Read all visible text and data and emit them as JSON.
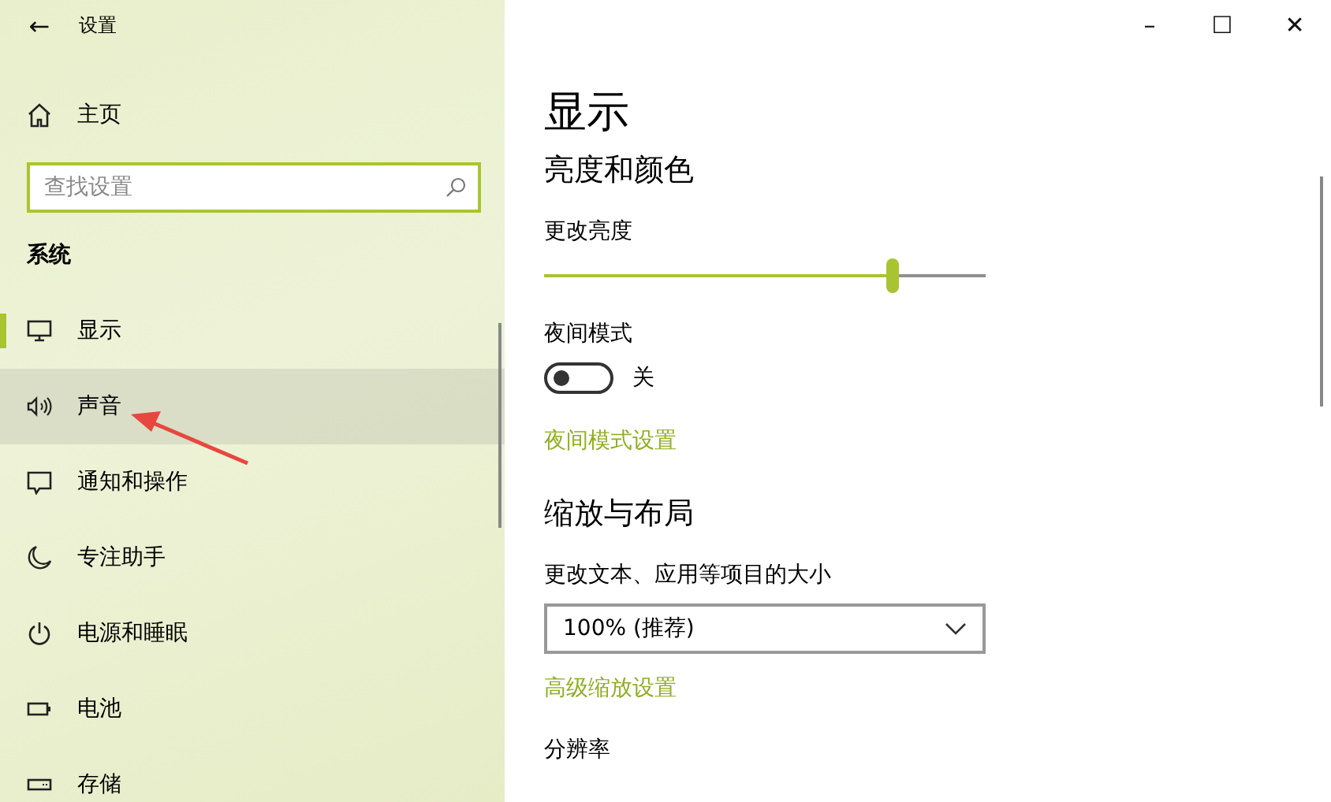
{
  "window": {
    "title": "设置",
    "back_glyph": "←",
    "controls": [
      "–",
      "☐",
      "✕"
    ]
  },
  "sidebar": {
    "home": "主页",
    "search": {
      "placeholder": "查找设置"
    },
    "section": "系统",
    "items": [
      {
        "label": "显示",
        "selected": true,
        "hovered": false
      },
      {
        "label": "声音",
        "selected": false,
        "hovered": true
      },
      {
        "label": "通知和操作",
        "selected": false,
        "hovered": false
      },
      {
        "label": "专注助手",
        "selected": false,
        "hovered": false
      },
      {
        "label": "电源和睡眠",
        "selected": false,
        "hovered": false
      },
      {
        "label": "电池",
        "selected": false,
        "hovered": false
      },
      {
        "label": "存储",
        "selected": false,
        "hovered": false
      }
    ]
  },
  "page": {
    "title": "显示",
    "brightness_section": {
      "heading": "亮度和颜色",
      "slider_label": "更改亮度",
      "level": 0.79
    },
    "night_light": {
      "label": "夜间模式",
      "on": false,
      "state_text": "关",
      "link": "夜间模式设置"
    },
    "scale_section": {
      "heading": "缩放与布局",
      "dropdown_label": "更改文本、应用等项目的大小",
      "dropdown_value": "100% (推荐)",
      "link": "高级缩放设置"
    },
    "resolution_label": "分辨率"
  }
}
